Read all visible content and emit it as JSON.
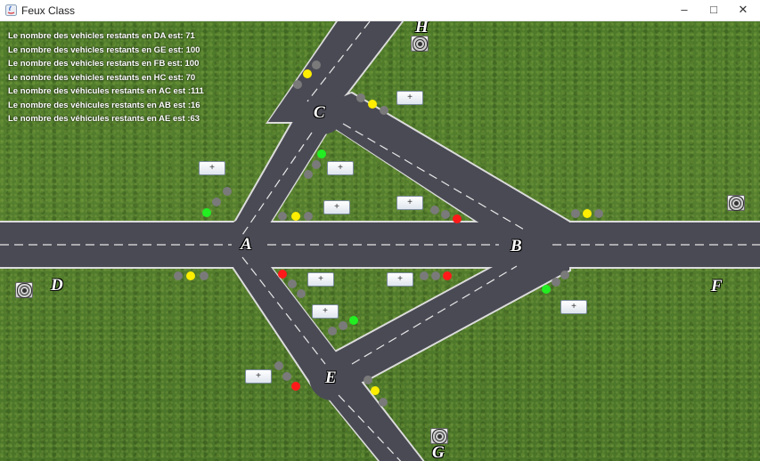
{
  "window": {
    "title": "Feux Class",
    "minimize_glyph": "–",
    "maximize_glyph": "□",
    "close_glyph": "✕"
  },
  "stats": [
    "Le nombre des vehicles restants en DA est: 71",
    "Le nombre des vehicles restants en GE est: 100",
    "Le nombre des vehicles restants en FB est: 100",
    "Le nombre des vehicles restants en HC est: 70",
    "Le nombre des véhicules restants en AC est :111",
    "Le nombre des véhicules restants en AB est :16",
    "Le nombre des véhicules restants en AE est :63"
  ],
  "nodes": {
    "A": "A",
    "B": "B",
    "C": "C",
    "D": "D",
    "E": "E",
    "F": "F",
    "G": "G",
    "H": "H"
  },
  "plus_label": "+",
  "colors": {
    "grass": "#4d7a2a",
    "road": "#4a4a55",
    "red": "#ff1a1a",
    "yellow": "#ffee00",
    "green": "#22ee22",
    "off": "#7a7a7a"
  },
  "traffic_lights": [
    {
      "id": "C-north",
      "states": [
        "off",
        "yellow",
        "off"
      ]
    },
    {
      "id": "C-east",
      "states": [
        "off",
        "yellow",
        "off"
      ]
    },
    {
      "id": "C-south",
      "states": [
        "off",
        "off",
        "green"
      ]
    },
    {
      "id": "A-north",
      "states": [
        "green",
        "off",
        "off"
      ]
    },
    {
      "id": "A-inner",
      "states": [
        "off",
        "yellow",
        "off"
      ]
    },
    {
      "id": "A-west",
      "states": [
        "off",
        "yellow",
        "off"
      ]
    },
    {
      "id": "A-south",
      "states": [
        "red",
        "off",
        "off"
      ]
    },
    {
      "id": "B-west-top",
      "states": [
        "off",
        "off",
        "red"
      ]
    },
    {
      "id": "B-west-bottom",
      "states": [
        "off",
        "off",
        "red"
      ]
    },
    {
      "id": "B-east",
      "states": [
        "off",
        "yellow",
        "off"
      ]
    },
    {
      "id": "B-south",
      "states": [
        "green",
        "off",
        "off"
      ]
    },
    {
      "id": "E-north",
      "states": [
        "off",
        "off",
        "green"
      ]
    },
    {
      "id": "E-west",
      "states": [
        "off",
        "off",
        "red"
      ]
    },
    {
      "id": "E-south",
      "states": [
        "off",
        "yellow",
        "off"
      ]
    }
  ]
}
